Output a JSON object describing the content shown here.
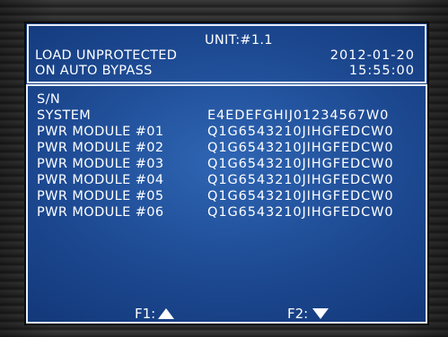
{
  "header": {
    "unit": "UNIT:#1.1",
    "status_line1": "LOAD UNPROTECTED",
    "status_line2": "ON AUTO BYPASS",
    "date": "2012-01-20",
    "time": "15:55:00"
  },
  "main": {
    "section_label": "S/N",
    "rows": [
      {
        "label": "SYSTEM",
        "value": "E4EDEFGHIJ01234567W0"
      },
      {
        "label": "PWR MODULE #01",
        "value": "Q1G6543210JIHGFEDCW0"
      },
      {
        "label": "PWR MODULE #02",
        "value": "Q1G6543210JIHGFEDCW0"
      },
      {
        "label": "PWR MODULE #03",
        "value": "Q1G6543210JIHGFEDCW0"
      },
      {
        "label": "PWR MODULE #04",
        "value": "Q1G6543210JIHGFEDCW0"
      },
      {
        "label": "PWR MODULE #05",
        "value": "Q1G6543210JIHGFEDCW0"
      },
      {
        "label": "PWR MODULE #06",
        "value": "Q1G6543210JIHGFEDCW0"
      }
    ]
  },
  "footer": {
    "f1_label": "F1:",
    "f1_icon": "arrow-up-icon",
    "f2_label": "F2:",
    "f2_icon": "arrow-down-icon"
  },
  "colors": {
    "screen_center": "#2f66b4",
    "screen_edge": "#143a7c",
    "text": "#ffffff",
    "bezel": "#2a2a2a"
  }
}
